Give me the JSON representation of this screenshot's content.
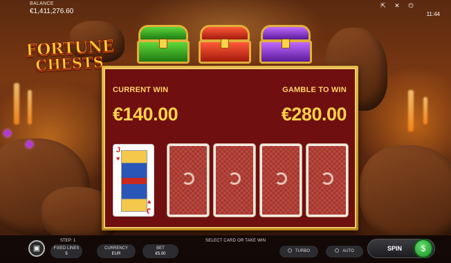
{
  "balance": {
    "label": "BALANCE",
    "value": "€1,411,276.60"
  },
  "top_icons": {
    "fullscreen": "fullscreen-icon",
    "sound": "mute-icon",
    "power": "power-icon"
  },
  "clock": "11:44",
  "logo": {
    "line1": "FORTUNE",
    "line2": "CHESTS"
  },
  "chests": [
    "green",
    "red",
    "purple"
  ],
  "gamble": {
    "current_win_label": "CURRENT WIN",
    "current_win_value": "€140.00",
    "gamble_to_win_label": "GAMBLE TO WIN",
    "gamble_to_win_value": "€280.00",
    "revealed_card": {
      "rank": "J",
      "suit": "♥"
    },
    "hidden_cards": 4
  },
  "bottom": {
    "step": "STEP: 1",
    "status": "SELECT CARD OR TAKE WIN",
    "fixed_lines_label": "FIXED LINES",
    "fixed_lines_value": "5",
    "currency_label": "CURRENCY",
    "currency_value": "EUR",
    "bet_label": "BET",
    "bet_value": "€5.00",
    "turbo_label": "TURBO",
    "auto_label": "AUTO",
    "spin_label": "SPIN"
  },
  "colors": {
    "panel_bg": "#6f0f0f",
    "gold": "#ffd24a",
    "card_back": "#a8332a",
    "spin_green": "#1b8a2a"
  }
}
